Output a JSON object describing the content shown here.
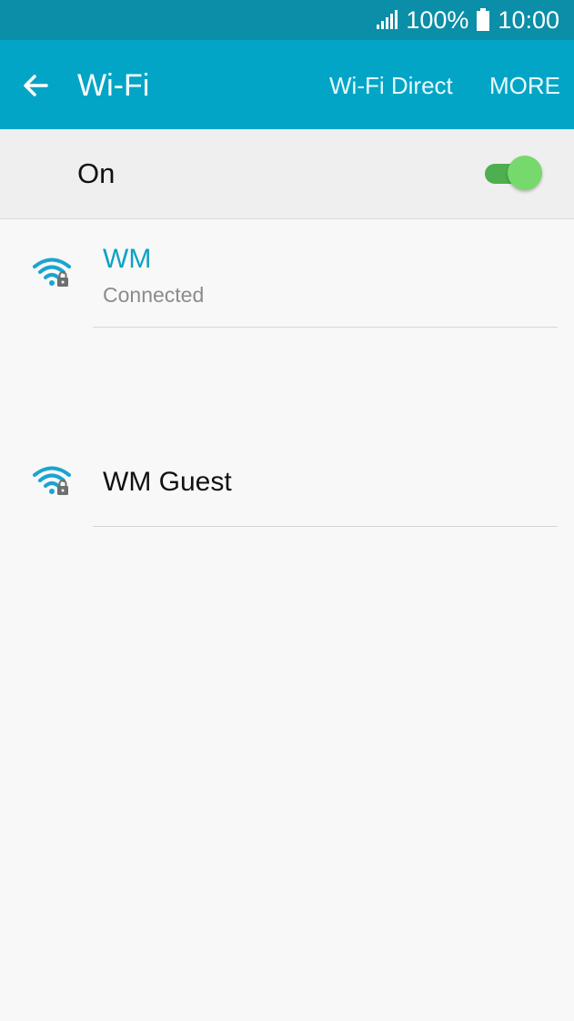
{
  "status_bar": {
    "battery": "100%",
    "time": "10:00",
    "signal_icon": "signal-icon",
    "battery_icon": "battery-icon",
    "color": "#0b8ea8"
  },
  "app_bar": {
    "title": "Wi-Fi",
    "back_icon": "back-arrow-icon",
    "actions": [
      {
        "label": "Wi-Fi Direct"
      },
      {
        "label": "MORE"
      }
    ],
    "color": "#03a5c6"
  },
  "wifi_toggle": {
    "label": "On",
    "state": true,
    "accent": "#4daf4f"
  },
  "networks": [
    {
      "name": "WM",
      "status": "Connected",
      "icon": "wifi-locked-icon",
      "connected": true,
      "name_color": "#0aa2c4"
    },
    {
      "name": "WM Guest",
      "status": "",
      "icon": "wifi-locked-icon",
      "connected": false
    }
  ]
}
